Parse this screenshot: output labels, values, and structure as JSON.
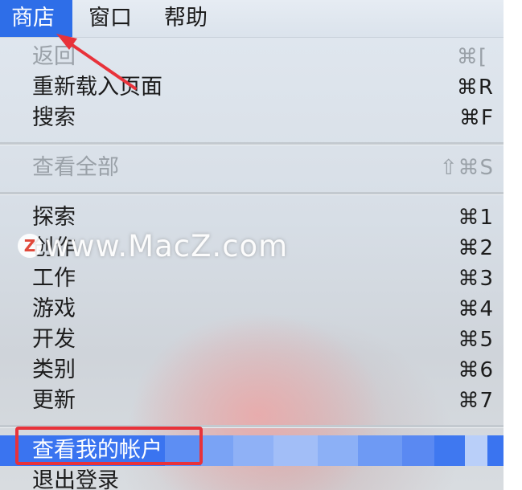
{
  "menubar": {
    "items": [
      {
        "label": "商店",
        "active": true
      },
      {
        "label": "窗口",
        "active": false
      },
      {
        "label": "帮助",
        "active": false
      }
    ]
  },
  "menu": {
    "back": {
      "label": "返回",
      "shortcut": "⌘[",
      "enabled": false
    },
    "reload": {
      "label": "重新载入页面",
      "shortcut": "⌘R",
      "enabled": true
    },
    "search": {
      "label": "搜索",
      "shortcut": "⌘F",
      "enabled": true
    },
    "view_all": {
      "label": "查看全部",
      "shortcut": "⇧⌘S",
      "enabled": false
    },
    "discover": {
      "label": "探索",
      "shortcut": "⌘1",
      "enabled": true
    },
    "create": {
      "label": "创作",
      "shortcut": "⌘2",
      "enabled": true
    },
    "work": {
      "label": "工作",
      "shortcut": "⌘3",
      "enabled": true
    },
    "games": {
      "label": "游戏",
      "shortcut": "⌘4",
      "enabled": true
    },
    "develop": {
      "label": "开发",
      "shortcut": "⌘5",
      "enabled": true
    },
    "categories": {
      "label": "类别",
      "shortcut": "⌘6",
      "enabled": true
    },
    "updates": {
      "label": "更新",
      "shortcut": "⌘7",
      "enabled": true
    },
    "view_account": {
      "label": "查看我的帐户",
      "shortcut": "",
      "enabled": true,
      "highlighted": true
    },
    "sign_out": {
      "label": "退出登录",
      "shortcut": "",
      "enabled": true
    }
  },
  "watermark": {
    "logo_letter": "Z",
    "text": "www.MacZ.com"
  },
  "colors": {
    "highlight": "#3a74f0",
    "annotation_red": "#e8323a",
    "menubar_active": "#2e6ee8"
  }
}
